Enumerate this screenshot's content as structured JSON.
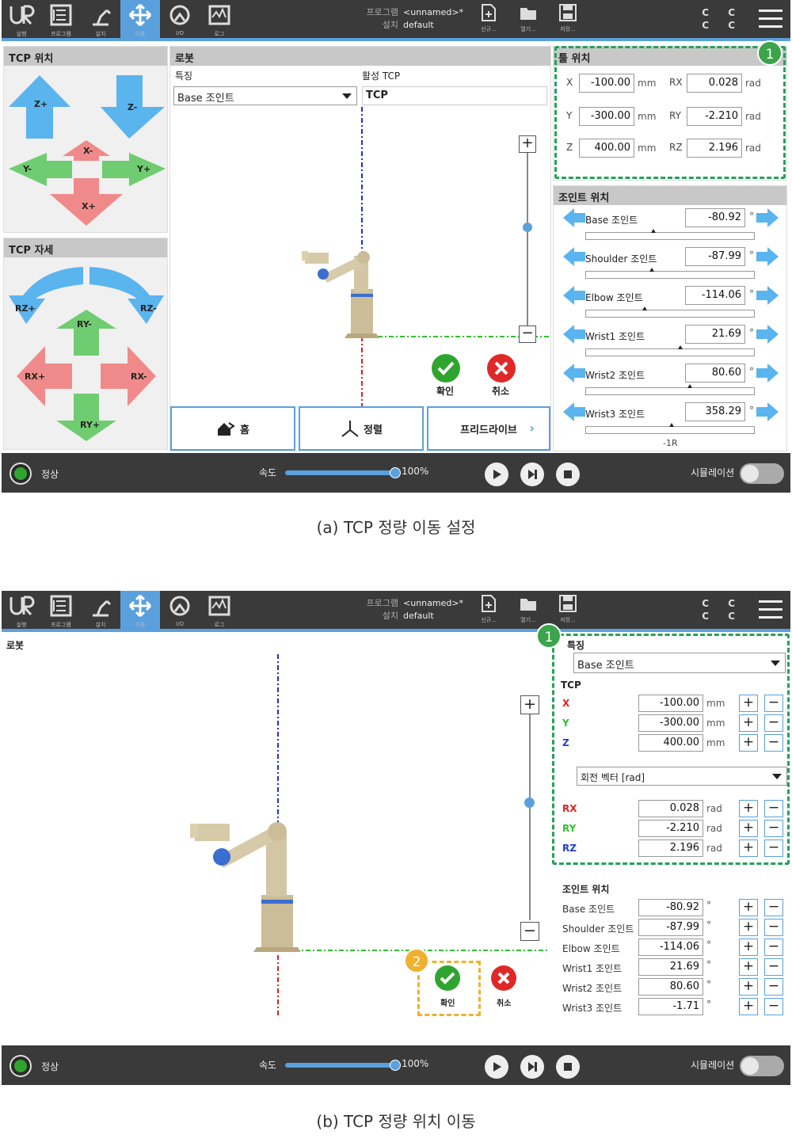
{
  "nav_items": [
    "실행",
    "프로그램",
    "설치",
    "이동",
    "I/O",
    "로그"
  ],
  "program": {
    "program_label": "프로그램",
    "program_name": "<unnamed>*",
    "install_label": "설치",
    "install_name": "default"
  },
  "file_menu": [
    "신규...",
    "열기...",
    "저장..."
  ],
  "bottom": {
    "status": "정상",
    "speed_label": "속도",
    "speed_value": "100%",
    "simulation_label": "시뮬레이션",
    "speed_fraction": 1.0
  },
  "panel_a": {
    "tcp_position_title": "TCP 위치",
    "tcp_orientation_title": "TCP 자세",
    "position_arrows": {
      "zplus": "Z+",
      "zminus": "Z-",
      "xminus": "X-",
      "yminus": "Y-",
      "yplus": "Y+",
      "xplus": "X+"
    },
    "orientation_arrows": {
      "rzplus": "RZ+",
      "rzminus": "RZ-",
      "ryminus": "RY-",
      "rxplus": "RX+",
      "rxminus": "RX-",
      "ryplus": "RY+"
    },
    "robot_title": "로봇",
    "feature_label": "특징",
    "feature_value": "Base 조인트",
    "active_tcp_label": "활성 TCP",
    "active_tcp_value": "TCP",
    "ok_label": "확인",
    "cancel_label": "취소",
    "home_button": "홈",
    "align_button": "정렬",
    "freedrive_button": "프리드라이브",
    "tool_position_title": "툴 위치",
    "tool": [
      {
        "axis": "X",
        "value": "-100.00",
        "unit": "mm"
      },
      {
        "axis": "Y",
        "value": "-300.00",
        "unit": "mm"
      },
      {
        "axis": "Z",
        "value": "400.00",
        "unit": "mm"
      }
    ],
    "tool_rot": [
      {
        "axis": "RX",
        "value": "0.028",
        "unit": "rad"
      },
      {
        "axis": "RY",
        "value": "-2.210",
        "unit": "rad"
      },
      {
        "axis": "RZ",
        "value": "2.196",
        "unit": "rad"
      }
    ],
    "joint_title": "조인트 위치",
    "joints": [
      {
        "name": "Base 조인트",
        "value": "-80.92",
        "unit": "°",
        "marker": 0.39
      },
      {
        "name": "Shoulder 조인트",
        "value": "-87.99",
        "unit": "°",
        "marker": 0.38
      },
      {
        "name": "Elbow 조인트",
        "value": "-114.06",
        "unit": "°",
        "marker": 0.34
      },
      {
        "name": "Wrist1 조인트",
        "value": "21.69",
        "unit": "°",
        "marker": 0.55
      },
      {
        "name": "Wrist2 조인트",
        "value": "80.60",
        "unit": "°",
        "marker": 0.61
      },
      {
        "name": "Wrist3 조인트",
        "value": "358.29",
        "unit": "°",
        "marker": 0.5
      }
    ],
    "wrist3_turn": "-1R",
    "badge": "1"
  },
  "panel_b": {
    "robot_title": "로봇",
    "feature_label": "특징",
    "feature_value": "Base 조인트",
    "tcp_label": "TCP",
    "tcp": [
      {
        "axis": "X",
        "value": "-100.00",
        "unit": "mm",
        "color": "#e02020"
      },
      {
        "axis": "Y",
        "value": "-300.00",
        "unit": "mm",
        "color": "#30c030"
      },
      {
        "axis": "Z",
        "value": "400.00",
        "unit": "mm",
        "color": "#2040d0"
      }
    ],
    "rotation_select": "회전 벡터 [rad]",
    "rot": [
      {
        "axis": "RX",
        "value": "0.028",
        "unit": "rad",
        "color": "#e02020"
      },
      {
        "axis": "RY",
        "value": "-2.210",
        "unit": "rad",
        "color": "#30c030"
      },
      {
        "axis": "RZ",
        "value": "2.196",
        "unit": "rad",
        "color": "#2040d0"
      }
    ],
    "joint_title": "조인트 위치",
    "joints": [
      {
        "name": "Base 조인트",
        "value": "-80.92",
        "unit": "°"
      },
      {
        "name": "Shoulder 조인트",
        "value": "-87.99",
        "unit": "°"
      },
      {
        "name": "Elbow 조인트",
        "value": "-114.06",
        "unit": "°"
      },
      {
        "name": "Wrist1 조인트",
        "value": "21.69",
        "unit": "°"
      },
      {
        "name": "Wrist2 조인트",
        "value": "80.60",
        "unit": "°"
      },
      {
        "name": "Wrist3 조인트",
        "value": "-1.71",
        "unit": "°"
      }
    ],
    "ok_label": "확인",
    "cancel_label": "취소",
    "badge1": "1",
    "badge2": "2"
  },
  "captions": {
    "a": "(a) TCP 정량 이동 설정",
    "b": "(b) TCP 정량 위치 이동"
  },
  "colors": {
    "accent": "#5aa0dc",
    "green_dash": "#22a25a",
    "orange_dash": "#f0b030",
    "arrow_blue": "#5ab4ee",
    "arrow_green": "#70cc70",
    "arrow_pink": "#f08a8a"
  }
}
